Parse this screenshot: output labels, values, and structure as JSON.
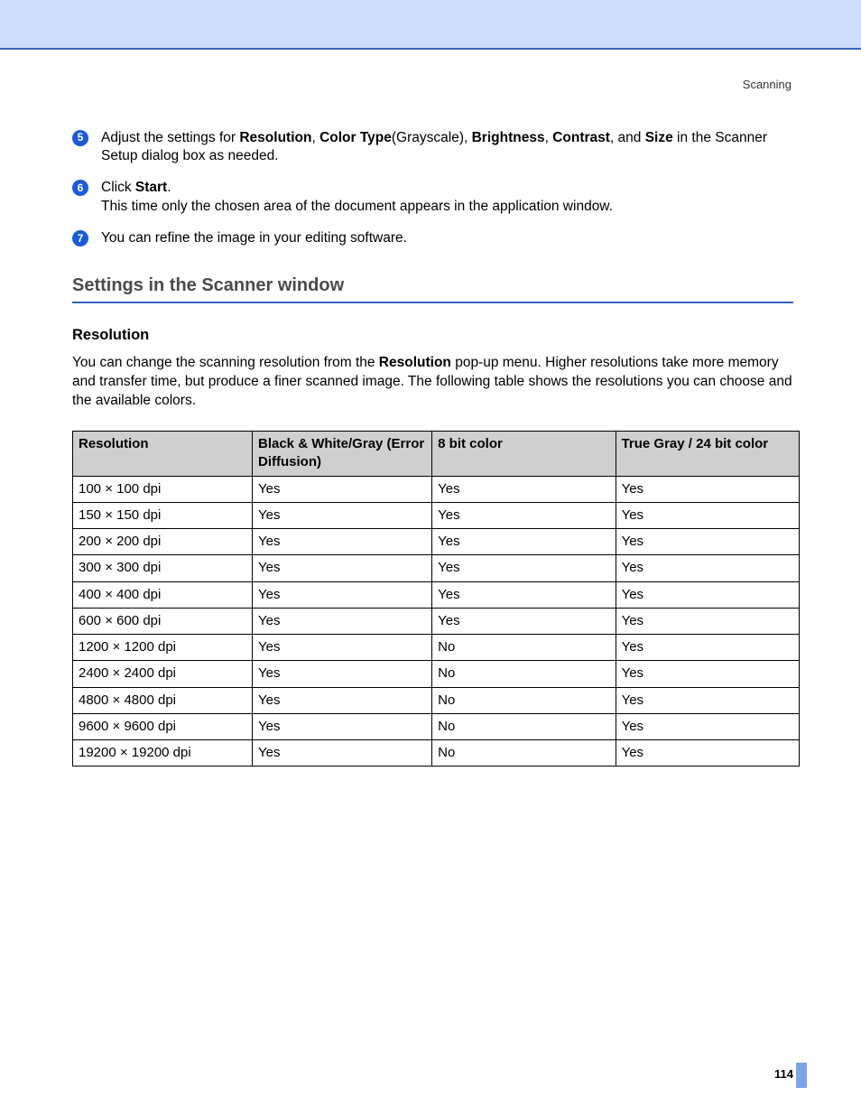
{
  "header": {
    "chapter": "Scanning"
  },
  "steps": [
    {
      "num": "5",
      "html": "Adjust the settings for <b>Resolution</b>, <b>Color Type</b>(Grayscale), <b>Brightness</b>, <b>Contrast</b>, and <b>Size</b> in the Scanner Setup dialog box as needed."
    },
    {
      "num": "6",
      "html": "Click <b>Start</b>.<br>This time only the chosen area of the document appears in the application window."
    },
    {
      "num": "7",
      "html": "You can refine the image in your editing software."
    }
  ],
  "section": {
    "title": "Settings in the Scanner window",
    "sub1": {
      "title": "Resolution",
      "intro_html": "You can change the scanning resolution from the <b>Resolution</b> pop-up menu. Higher resolutions take more memory and transfer time, but produce a finer scanned image. The following table shows the resolutions you can choose and the available colors."
    }
  },
  "table": {
    "headers": [
      "Resolution",
      "Black & White/Gray (Error Diffusion)",
      "8 bit color",
      "True Gray / 24 bit color"
    ],
    "rows": [
      [
        "100 × 100 dpi",
        "Yes",
        "Yes",
        "Yes"
      ],
      [
        "150 × 150 dpi",
        "Yes",
        "Yes",
        "Yes"
      ],
      [
        "200 × 200 dpi",
        "Yes",
        "Yes",
        "Yes"
      ],
      [
        "300 × 300 dpi",
        "Yes",
        "Yes",
        "Yes"
      ],
      [
        "400 × 400 dpi",
        "Yes",
        "Yes",
        "Yes"
      ],
      [
        "600 × 600 dpi",
        "Yes",
        "Yes",
        "Yes"
      ],
      [
        "1200 × 1200 dpi",
        "Yes",
        "No",
        "Yes"
      ],
      [
        "2400 × 2400 dpi",
        "Yes",
        "No",
        "Yes"
      ],
      [
        "4800 × 4800 dpi",
        "Yes",
        "No",
        "Yes"
      ],
      [
        "9600 × 9600 dpi",
        "Yes",
        "No",
        "Yes"
      ],
      [
        "19200 × 19200 dpi",
        "Yes",
        "No",
        "Yes"
      ]
    ]
  },
  "footer": {
    "page": "114"
  }
}
